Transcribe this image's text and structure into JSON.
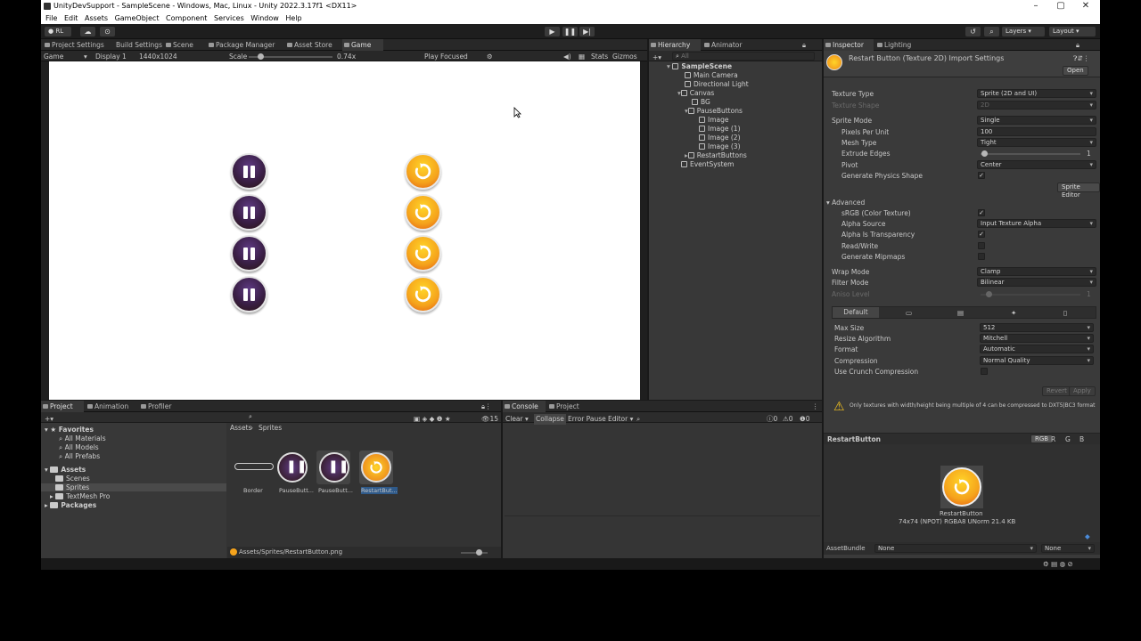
{
  "window": {
    "title": "UnityDevSupport - SampleScene - Windows, Mac, Linux - Unity 2022.3.17f1 <DX11>"
  },
  "menu": [
    "File",
    "Edit",
    "Assets",
    "GameObject",
    "Component",
    "Services",
    "Window",
    "Help"
  ],
  "toolbar": {
    "account": "RL",
    "layers": "Layers",
    "layout": "Layout"
  },
  "main_tabs": [
    "Project Settings",
    "Build Settings",
    "Scene",
    "Package Manager",
    "Asset Store",
    "Game"
  ],
  "game_bar": {
    "mode": "Game",
    "display": "Display 1",
    "resolution": "1440x1024",
    "scale_label": "Scale",
    "scale_value": "0.74x",
    "play_focused": "Play Focused",
    "stats": "Stats",
    "gizmos": "Gizmos"
  },
  "hierarchy": {
    "tabs": [
      "Hierarchy",
      "Animator"
    ],
    "search_placeholder": "All",
    "items": [
      "SampleScene",
      "Main Camera",
      "Directional Light",
      "Canvas",
      "BG",
      "PauseButtons",
      "Image",
      "Image (1)",
      "Image (2)",
      "Image (3)",
      "RestartButtons",
      "EventSystem"
    ]
  },
  "inspector": {
    "tabs": [
      "Inspector",
      "Lighting"
    ],
    "header": "Restart Button (Texture 2D) Import Settings",
    "open_label": "Open",
    "rows": [
      {
        "label": "Texture Type",
        "value": "Sprite (2D and UI)"
      },
      {
        "label": "Texture Shape",
        "value": "2D"
      },
      {
        "label": "Sprite Mode",
        "value": "Single"
      },
      {
        "label": "Pixels Per Unit",
        "value": "100"
      },
      {
        "label": "Mesh Type",
        "value": "Tight"
      },
      {
        "label": "Extrude Edges",
        "value": "1"
      },
      {
        "label": "Pivot",
        "value": "Center"
      },
      {
        "label": "Generate Physics Shape",
        "value": "✓"
      }
    ],
    "sprite_editor": "Sprite Editor",
    "advanced": "Advanced",
    "adv_rows": [
      {
        "label": "sRGB (Color Texture)",
        "value": "✓"
      },
      {
        "label": "Alpha Source",
        "value": "Input Texture Alpha"
      },
      {
        "label": "Alpha Is Transparency",
        "value": "✓"
      },
      {
        "label": "Read/Write",
        "value": ""
      },
      {
        "label": "Generate Mipmaps",
        "value": ""
      }
    ],
    "wrap_label": "Wrap Mode",
    "wrap_value": "Clamp",
    "filter_label": "Filter Mode",
    "filter_value": "Bilinear",
    "aniso_label": "Aniso Level",
    "aniso_value": "1",
    "platform_tab": "Default",
    "plat_rows": [
      {
        "label": "Max Size",
        "value": "512"
      },
      {
        "label": "Resize Algorithm",
        "value": "Mitchell"
      },
      {
        "label": "Format",
        "value": "Automatic"
      },
      {
        "label": "Compression",
        "value": "Normal Quality"
      },
      {
        "label": "Use Crunch Compression",
        "value": ""
      }
    ],
    "revert": "Revert",
    "apply": "Apply",
    "warning": "Only textures with width/height being multiple of 4 can be compressed to DXT5|BC3 format",
    "preview_title": "RestartButton",
    "channels": [
      "RGB",
      "R",
      "G",
      "B"
    ],
    "preview_name": "RestartButton",
    "preview_info": "74x74 (NPOT)  RGBA8 UNorm  21.4 KB",
    "assetbundle_label": "AssetBundle",
    "assetbundle_value": "None",
    "assetbundle_variant": "None"
  },
  "project": {
    "tabs": [
      "Project",
      "Animation",
      "Profiler"
    ],
    "favorites": "Favorites",
    "fav_items": [
      "All Materials",
      "All Models",
      "All Prefabs"
    ],
    "assets": "Assets",
    "asset_items": [
      "Scenes",
      "Sprites",
      "TextMesh Pro"
    ],
    "packages": "Packages",
    "breadcrumb": [
      "Assets",
      "Sprites"
    ],
    "thumbs": [
      "Border",
      "PauseButt...",
      "PauseButt...",
      "RestartBut..."
    ],
    "count": "15",
    "footer": "Assets/Sprites/RestartButton.png"
  },
  "console": {
    "tabs": [
      "Console",
      "Project"
    ],
    "clear": "Clear",
    "collapse": "Collapse",
    "error_pause": "Error Pause",
    "editor": "Editor",
    "counts": [
      "0",
      "0",
      "0"
    ]
  },
  "colors": {
    "accent": "#3a72b0",
    "pause": "#3a1f46",
    "restart": "#f5a31c"
  }
}
